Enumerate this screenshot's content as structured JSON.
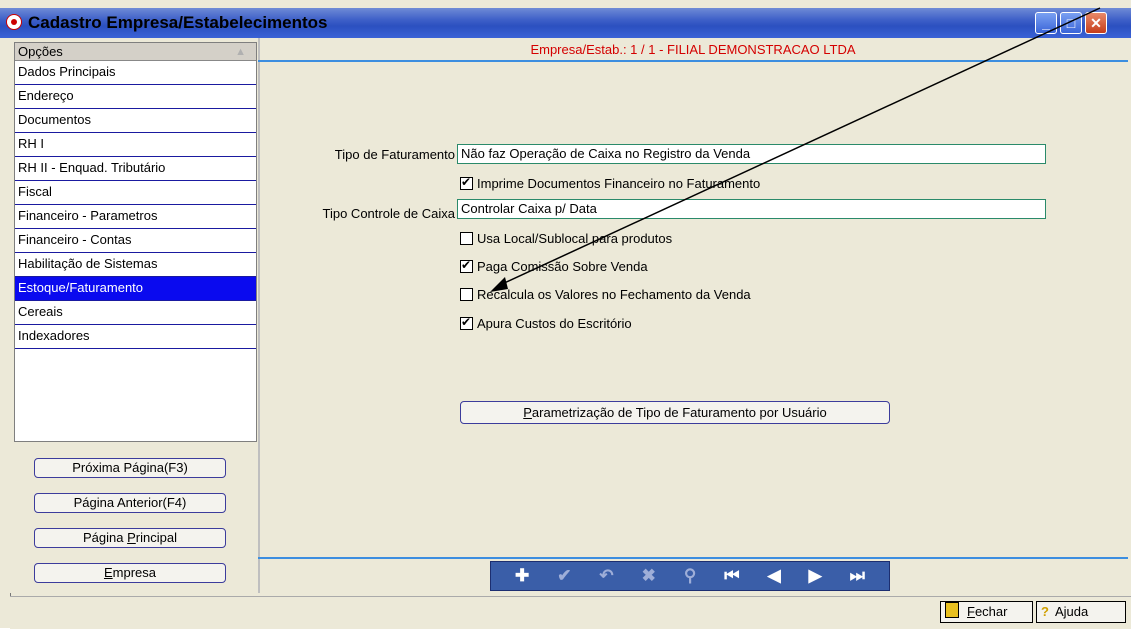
{
  "window": {
    "title": "Cadastro Empresa/Estabelecimentos",
    "minimize": "_",
    "maximize": "□",
    "close": "✕"
  },
  "options": {
    "header": "Opções",
    "items": [
      {
        "label": "Dados Principais"
      },
      {
        "label": "Endereço"
      },
      {
        "label": "Documentos"
      },
      {
        "label": "RH I"
      },
      {
        "label": "RH II - Enquad. Tributário"
      },
      {
        "label": "Fiscal"
      },
      {
        "label": "Financeiro - Parametros"
      },
      {
        "label": "Financeiro - Contas"
      },
      {
        "label": "Habilitação de Sistemas"
      },
      {
        "label": "Estoque/Faturamento"
      },
      {
        "label": "Cereais"
      },
      {
        "label": "Indexadores"
      }
    ],
    "selected": "Estoque/Faturamento"
  },
  "nav_buttons": {
    "next": "Próxima Página(F3)",
    "prev": "Página Anterior(F4)",
    "main_pre": "Página ",
    "main_u": "P",
    "main_post": "rincipal",
    "empresa_u": "E",
    "empresa_post": "mpresa"
  },
  "header": {
    "empresa": "Empresa/Estab.: 1 / 1 - FILIAL DEMONSTRACAO LTDA"
  },
  "form": {
    "tipo_faturamento_label": "Tipo de Faturamento",
    "tipo_faturamento_value": "Não faz Operação de Caixa no Registro da Venda",
    "tipo_controle_label": "Tipo Controle de Caixa",
    "tipo_controle_value": "Controlar Caixa p/ Data",
    "checkboxes": [
      {
        "label": "Imprime Documentos Financeiro no Faturamento",
        "checked": true
      },
      {
        "label": "Usa Local/Sublocal para produtos",
        "checked": false
      },
      {
        "label": "Paga Comissão Sobre Venda",
        "checked": true
      },
      {
        "label": "Recalcula os Valores no Fechamento da Venda",
        "checked": false
      },
      {
        "label": "Apura Custos do Escritório",
        "checked": true
      }
    ],
    "param_button_u": "P",
    "param_button_rest": "arametrização de Tipo de Faturamento por Usuário"
  },
  "toolbar": {
    "icons": [
      "plus-icon",
      "check-icon",
      "undo-icon",
      "delete-icon",
      "search-icon",
      "first-icon",
      "prev-icon",
      "next-icon",
      "last-icon"
    ],
    "glyphs": [
      "✚",
      "✔",
      "↶",
      "✖",
      "⚲",
      "⏮",
      "◀",
      "▶",
      "⏭"
    ]
  },
  "footer": {
    "fechar_u": "F",
    "fechar_rest": "echar",
    "ajuda": "Ajuda"
  }
}
